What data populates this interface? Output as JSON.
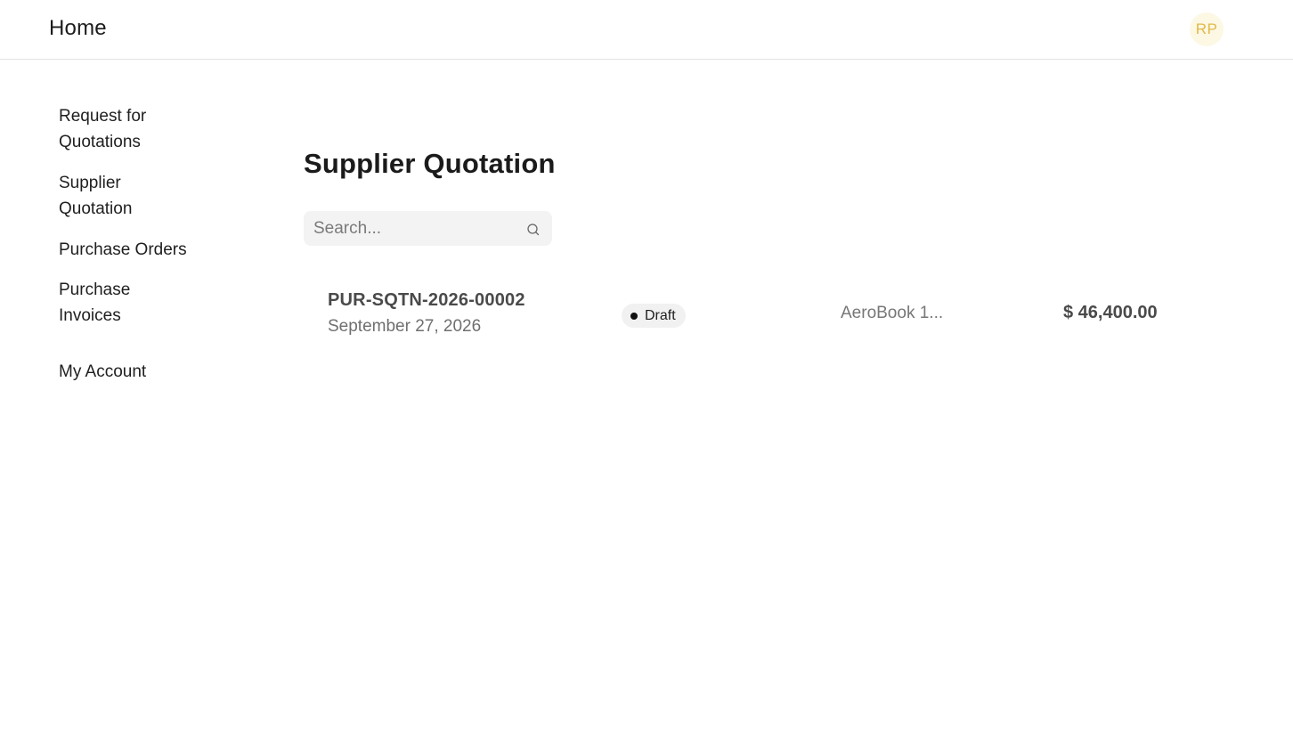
{
  "navbar": {
    "brand": "Home",
    "avatar_initials": "RP",
    "avatar_bg": "#fdf8e4",
    "avatar_color": "#e0b94a"
  },
  "sidebar": {
    "items": [
      {
        "label": "Request for Quotations"
      },
      {
        "label": "Supplier Quotation"
      },
      {
        "label": "Purchase Orders"
      },
      {
        "label": "Purchase Invoices"
      },
      {
        "label": "My Account"
      }
    ]
  },
  "main": {
    "title": "Supplier Quotation",
    "search": {
      "placeholder": "Search...",
      "value": "",
      "icon": "search-icon"
    },
    "rows": [
      {
        "id": "PUR-SQTN-2026-00002",
        "date": "September 27, 2026",
        "status": "Draft",
        "item": "AeroBook 1...",
        "amount": "$ 46,400.00"
      }
    ]
  }
}
